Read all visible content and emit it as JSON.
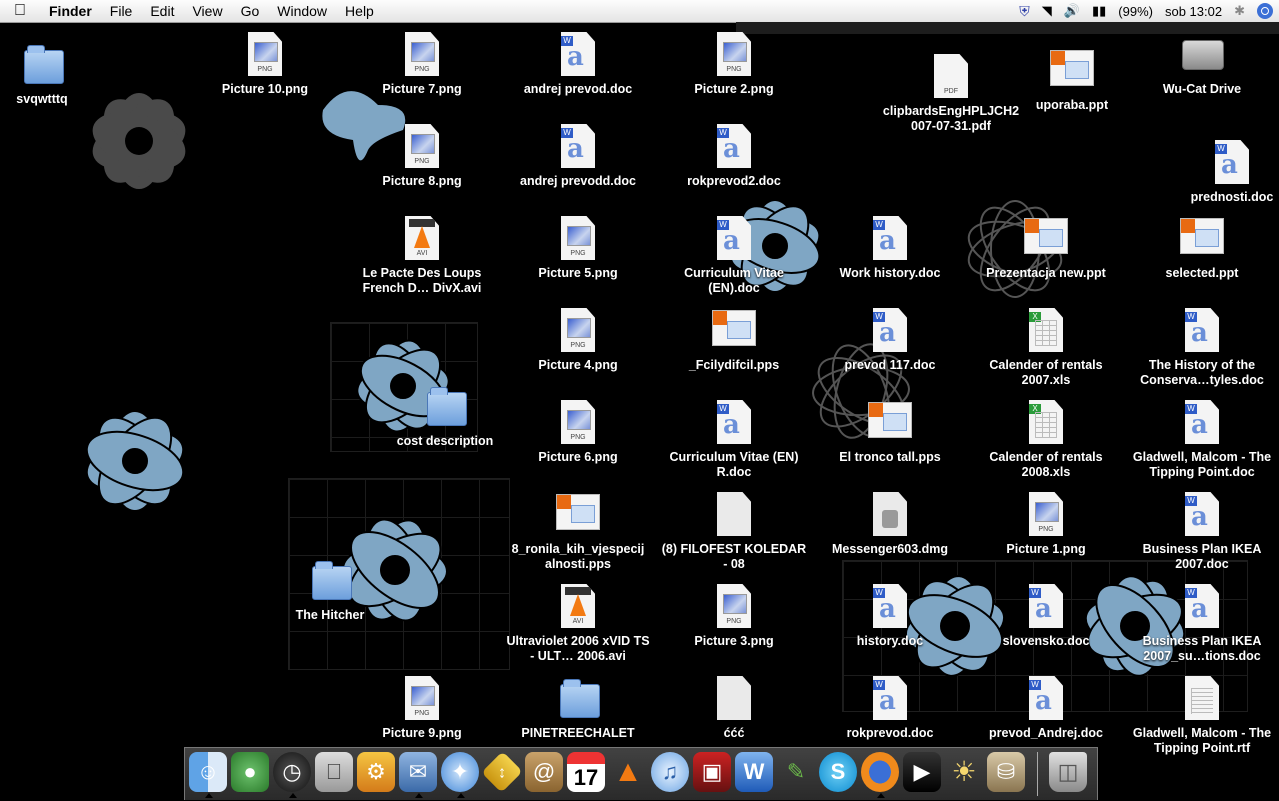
{
  "menubar": {
    "app": "Finder",
    "menus": [
      "File",
      "Edit",
      "View",
      "Go",
      "Window",
      "Help"
    ],
    "battery": "(99%)",
    "clock": "sob 13:02"
  },
  "desktop": {
    "icons": {
      "svqwtttq": "svqwtttq",
      "picture10": "Picture 10.png",
      "picture7": "Picture 7.png",
      "andrej_prevod": "andrej prevod.doc",
      "picture2": "Picture 2.png",
      "clipbards": "clipbardsEngHPLJCH2 007-07-31.pdf",
      "uporaba": "uporaba.ppt",
      "wucat": "Wu-Cat Drive",
      "picture8": "Picture 8.png",
      "andrej_prevodd": "andrej prevodd.doc",
      "rokprevod2": "rokprevod2.doc",
      "prednosti": "prednosti.doc",
      "lepacte": "Le Pacte Des Loups French D… DivX.avi",
      "picture5": "Picture 5.png",
      "cv_en": "Curriculum Vitae (EN).doc",
      "work_history": "Work history.doc",
      "prezentacja": "Prezentacja new.ppt",
      "selected": "selected.ppt",
      "picture4": "Picture 4.png",
      "fcily": "_Fcilydifcil.pps",
      "prevod117": "prevod 117.doc",
      "cal2007": "Calender of rentals 2007.xls",
      "history_conserv": "The History of the Conserva…tyles.doc",
      "cost_description": "cost description",
      "picture6": "Picture 6.png",
      "cv_en_r": "Curriculum Vitae (EN) R.doc",
      "el_tronco": "El tronco tall.pps",
      "cal2008": "Calender of rentals 2008.xls",
      "gladwell_doc": "Gladwell, Malcom - The Tipping Point.doc",
      "ronila": "8_ronila_kih_vjespecij alnosti.pps",
      "filofest": "(8) FILOFEST KOLEDAR - 08",
      "messenger": "Messenger603.dmg",
      "picture1": "Picture 1.png",
      "bp_ikea": "Business Plan IKEA 2007.doc",
      "the_hitcher": "The Hitcher",
      "ultraviolet": "Ultraviolet 2006 xVID TS - ULT… 2006.avi",
      "picture3": "Picture 3.png",
      "history": "history.doc",
      "slovensko": "slovensko.doc",
      "bp_ikea_sug": "Business Plan IKEA 2007_su…tions.doc",
      "picture9": "Picture 9.png",
      "pinetree": "PINETREECHALET",
      "cccc": "ććć",
      "rokprevod": "rokprevod.doc",
      "prevod_andrej": "prevod_Andrej.doc",
      "gladwell_rtf": "Gladwell, Malcom - The Tipping Point.rtf"
    },
    "file_tags": {
      "png": "PNG",
      "pdf": "PDF",
      "avi": "AVI"
    }
  },
  "dock": {
    "icons": [
      "finder-icon",
      "messenger-icon",
      "dashboard-icon",
      "system-prefs-icon",
      "widget-icon",
      "mail-icon",
      "safari-icon",
      "transmit-icon",
      "address-book-icon",
      "ical-icon",
      "vlc-icon",
      "itunes-icon",
      "photo-booth-icon",
      "word-icon",
      "pen-icon",
      "skype-icon",
      "firefox-icon",
      "imovie-icon",
      "idea-icon",
      "preview-icon",
      "trash-icon"
    ]
  }
}
